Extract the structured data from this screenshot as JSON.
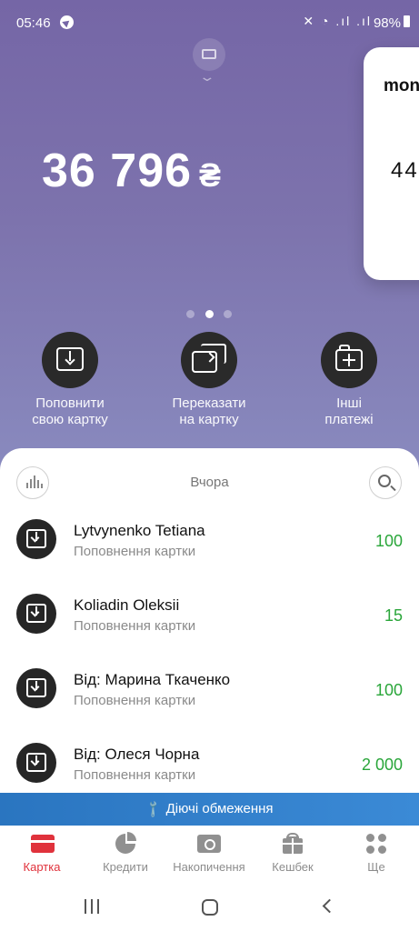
{
  "status_bar": {
    "time": "05:46",
    "battery": "98%",
    "icons": [
      "mute-icon",
      "wifi-icon",
      "signal-icon",
      "signal-icon",
      "battery-icon"
    ]
  },
  "balance": {
    "amount": "36 796",
    "currency": "₴"
  },
  "side_card": {
    "title": "mon",
    "amount": "44"
  },
  "carousel": {
    "page_count": 3,
    "active_index": 1
  },
  "actions": [
    {
      "label_line1": "Поповнити",
      "label_line2": "свою картку",
      "icon": "download-icon"
    },
    {
      "label_line1": "Переказати",
      "label_line2": "на картку",
      "icon": "transfer-icon"
    },
    {
      "label_line1": "Інші",
      "label_line2": "платежі",
      "icon": "folder-plus-icon"
    }
  ],
  "feed": {
    "day_label": "Вчора",
    "transactions": [
      {
        "name": "Lytvynenko Tetiana",
        "subtitle": "Поповнення картки",
        "amount": "100"
      },
      {
        "name": "Koliadin Oleksii",
        "subtitle": "Поповнення картки",
        "amount": "15"
      },
      {
        "name": "Від: Марина Ткаченко",
        "subtitle": "Поповнення картки",
        "amount": "100"
      },
      {
        "name": "Від: Олеся Чорна",
        "subtitle": "Поповнення картки",
        "amount": "2 000"
      }
    ]
  },
  "limits_bar": {
    "label": "Діючі обмеження"
  },
  "bottom_nav": [
    {
      "label": "Картка",
      "active": true
    },
    {
      "label": "Кредити",
      "active": false
    },
    {
      "label": "Накопичення",
      "active": false
    },
    {
      "label": "Кешбек",
      "active": false
    },
    {
      "label": "Ще",
      "active": false
    }
  ],
  "colors": {
    "accent_red": "#e0323c",
    "income_green": "#2aa63a",
    "limits_blue": "#2a75c0",
    "hero_purple": "#7566a6"
  }
}
